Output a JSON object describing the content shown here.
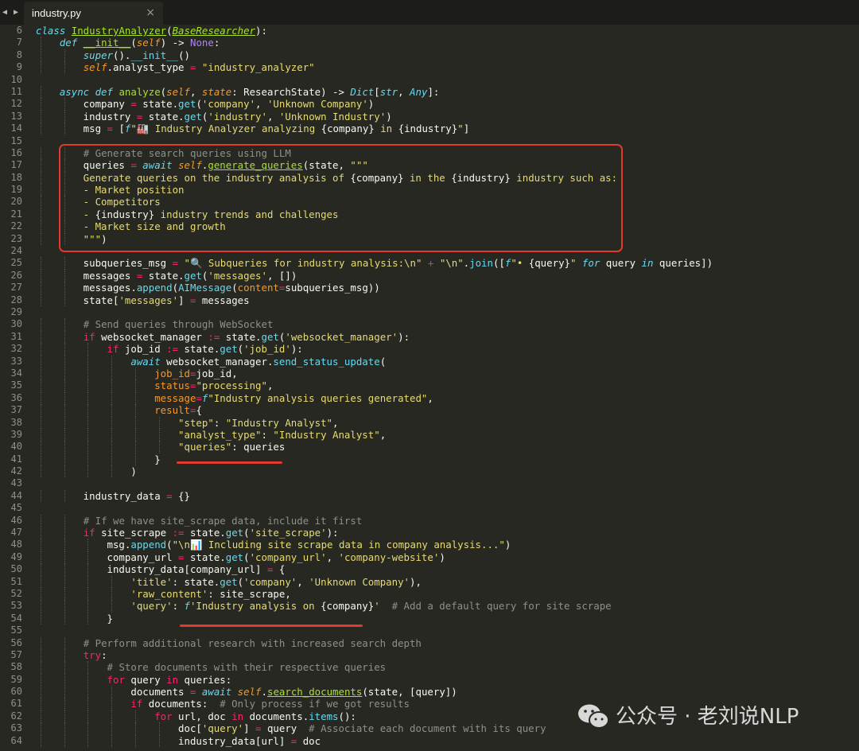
{
  "tab": {
    "title": "industry.py",
    "close": "×"
  },
  "nav_arrows": "◀ ▶",
  "line_numbers": [
    "6",
    "7",
    "8",
    "9",
    "10",
    "11",
    "12",
    "13",
    "14",
    "15",
    "16",
    "17",
    "18",
    "19",
    "20",
    "21",
    "22",
    "23",
    "24",
    "25",
    "26",
    "27",
    "28",
    "29",
    "30",
    "31",
    "32",
    "33",
    "34",
    "35",
    "36",
    "37",
    "38",
    "39",
    "40",
    "41",
    "42",
    "43",
    "44",
    "45",
    "46",
    "47",
    "48",
    "49",
    "50",
    "51",
    "52",
    "53",
    "54",
    "55",
    "56",
    "57",
    "58",
    "59",
    "60",
    "61",
    "62",
    "63",
    "64"
  ],
  "code_lines": [
    [
      [
        "kw",
        "class "
      ],
      [
        "cls",
        "IndustryAnalyzer"
      ],
      [
        "",
        "("
      ],
      [
        "inh",
        "BaseResearcher"
      ],
      [
        "",
        "):"
      ]
    ],
    [
      [
        "",
        "    "
      ],
      [
        "kw",
        "def "
      ],
      [
        "fnu",
        "__init__"
      ],
      [
        "",
        "("
      ],
      [
        "prm",
        "self"
      ],
      [
        "",
        ") -> "
      ],
      [
        "none",
        "None"
      ],
      [
        "",
        ":"
      ]
    ],
    [
      [
        "",
        "        "
      ],
      [
        "kw",
        "super"
      ],
      [
        "",
        "()."
      ],
      [
        "mth",
        "__init__"
      ],
      [
        "",
        "()"
      ]
    ],
    [
      [
        "",
        "        "
      ],
      [
        "self",
        "self"
      ],
      [
        "",
        ".analyst_type "
      ],
      [
        "op",
        "="
      ],
      [
        "",
        " "
      ],
      [
        "str",
        "\"industry_analyzer\""
      ]
    ],
    [
      [
        "",
        ""
      ]
    ],
    [
      [
        "",
        "    "
      ],
      [
        "kw",
        "async def "
      ],
      [
        "fn",
        "analyze"
      ],
      [
        "",
        "("
      ],
      [
        "prm",
        "self"
      ],
      [
        "",
        ", "
      ],
      [
        "prm",
        "state"
      ],
      [
        "",
        ": ResearchState) -> "
      ],
      [
        "typ",
        "Dict"
      ],
      [
        "",
        "["
      ],
      [
        "typ",
        "str"
      ],
      [
        "",
        ", "
      ],
      [
        "typ",
        "Any"
      ],
      [
        "",
        "]:"
      ]
    ],
    [
      [
        "",
        "        company "
      ],
      [
        "op",
        "="
      ],
      [
        "",
        " state."
      ],
      [
        "mth",
        "get"
      ],
      [
        "",
        "("
      ],
      [
        "str",
        "'company'"
      ],
      [
        "",
        ", "
      ],
      [
        "str",
        "'Unknown Company'"
      ],
      [
        "",
        ")"
      ]
    ],
    [
      [
        "",
        "        industry "
      ],
      [
        "op",
        "="
      ],
      [
        "",
        " state."
      ],
      [
        "mth",
        "get"
      ],
      [
        "",
        "("
      ],
      [
        "str",
        "'industry'"
      ],
      [
        "",
        ", "
      ],
      [
        "str",
        "'Unknown Industry'"
      ],
      [
        "",
        ")"
      ]
    ],
    [
      [
        "",
        "        msg "
      ],
      [
        "op",
        "="
      ],
      [
        "",
        " ["
      ],
      [
        "kw",
        "f"
      ],
      [
        "str",
        "\"🏭 Industry Analyzer analyzing "
      ],
      [
        "",
        "{company}"
      ],
      [
        "str",
        " in "
      ],
      [
        "",
        "{industry}"
      ],
      [
        "str",
        "\""
      ],
      [
        "",
        "]"
      ]
    ],
    [
      [
        "",
        ""
      ]
    ],
    [
      [
        "",
        "        "
      ],
      [
        "cmt",
        "# Generate search queries using LLM"
      ]
    ],
    [
      [
        "",
        "        queries "
      ],
      [
        "op",
        "="
      ],
      [
        "",
        " "
      ],
      [
        "kw",
        "await "
      ],
      [
        "self",
        "self"
      ],
      [
        "",
        "."
      ],
      [
        "fnu",
        "generate_queries"
      ],
      [
        "",
        "(state, "
      ],
      [
        "str",
        "\"\"\""
      ]
    ],
    [
      [
        "str",
        "        Generate queries on the industry analysis of "
      ],
      [
        "",
        "{company}"
      ],
      [
        "str",
        " in the "
      ],
      [
        "",
        "{industry}"
      ],
      [
        "str",
        " industry such as:"
      ]
    ],
    [
      [
        "str",
        "        - Market position"
      ]
    ],
    [
      [
        "str",
        "        - Competitors"
      ]
    ],
    [
      [
        "str",
        "        - "
      ],
      [
        "",
        "{industry}"
      ],
      [
        "str",
        " industry trends and challenges"
      ]
    ],
    [
      [
        "str",
        "        - Market size and growth"
      ]
    ],
    [
      [
        "str",
        "        \"\"\""
      ],
      [
        "",
        ")"
      ]
    ],
    [
      [
        "",
        ""
      ]
    ],
    [
      [
        "",
        "        subqueries_msg "
      ],
      [
        "op",
        "="
      ],
      [
        "",
        " "
      ],
      [
        "str",
        "\"🔍 Subqueries for industry analysis:\\n\""
      ],
      [
        "",
        " "
      ],
      [
        "op",
        "+"
      ],
      [
        "",
        " "
      ],
      [
        "str",
        "\"\\n\""
      ],
      [
        "",
        "."
      ],
      [
        "mth",
        "join"
      ],
      [
        "",
        "(["
      ],
      [
        "kw",
        "f"
      ],
      [
        "str",
        "\"• "
      ],
      [
        "",
        "{query}"
      ],
      [
        "str",
        "\""
      ],
      [
        "",
        " "
      ],
      [
        "kw",
        "for"
      ],
      [
        "",
        ""
      ],
      [
        "",
        " query "
      ],
      [
        "kw",
        "in"
      ],
      [
        "",
        " queries])"
      ]
    ],
    [
      [
        "",
        "        messages "
      ],
      [
        "op",
        "="
      ],
      [
        "",
        " state."
      ],
      [
        "mth",
        "get"
      ],
      [
        "",
        "("
      ],
      [
        "str",
        "'messages'"
      ],
      [
        "",
        ", [])"
      ]
    ],
    [
      [
        "",
        "        messages."
      ],
      [
        "mth",
        "append"
      ],
      [
        "",
        "("
      ],
      [
        "mth",
        "AIMessage"
      ],
      [
        "",
        "("
      ],
      [
        "arg",
        "content"
      ],
      [
        "op",
        "="
      ],
      [
        "",
        "subqueries_msg))"
      ]
    ],
    [
      [
        "",
        "        state["
      ],
      [
        "str",
        "'messages'"
      ],
      [
        "",
        "] "
      ],
      [
        "op",
        "="
      ],
      [
        "",
        " messages"
      ]
    ],
    [
      [
        "",
        ""
      ]
    ],
    [
      [
        "",
        "        "
      ],
      [
        "cmt",
        "# Send queries through WebSocket"
      ]
    ],
    [
      [
        "",
        "        "
      ],
      [
        "op",
        "if"
      ],
      [
        "",
        " websocket_manager "
      ],
      [
        "op",
        ":="
      ],
      [
        "",
        " state."
      ],
      [
        "mth",
        "get"
      ],
      [
        "",
        "("
      ],
      [
        "str",
        "'websocket_manager'"
      ],
      [
        "",
        "):"
      ]
    ],
    [
      [
        "",
        "            "
      ],
      [
        "op",
        "if"
      ],
      [
        "",
        " job_id "
      ],
      [
        "op",
        ":="
      ],
      [
        "",
        " state."
      ],
      [
        "mth",
        "get"
      ],
      [
        "",
        "("
      ],
      [
        "str",
        "'job_id'"
      ],
      [
        "",
        "):"
      ]
    ],
    [
      [
        "",
        "                "
      ],
      [
        "kw",
        "await "
      ],
      [
        "",
        "websocket_manager."
      ],
      [
        "mth",
        "send_status_update"
      ],
      [
        "",
        "("
      ]
    ],
    [
      [
        "",
        "                    "
      ],
      [
        "arg",
        "job_id"
      ],
      [
        "op",
        "="
      ],
      [
        "",
        "job_id,"
      ]
    ],
    [
      [
        "",
        "                    "
      ],
      [
        "arg",
        "status"
      ],
      [
        "op",
        "="
      ],
      [
        "str",
        "\"processing\""
      ],
      [
        "",
        ","
      ]
    ],
    [
      [
        "",
        "                    "
      ],
      [
        "arg",
        "message"
      ],
      [
        "op",
        "="
      ],
      [
        "kw",
        "f"
      ],
      [
        "str",
        "\"Industry analysis queries generated\""
      ],
      [
        "",
        ","
      ]
    ],
    [
      [
        "",
        "                    "
      ],
      [
        "arg",
        "result"
      ],
      [
        "op",
        "="
      ],
      [
        "",
        "{"
      ]
    ],
    [
      [
        "",
        "                        "
      ],
      [
        "str",
        "\"step\""
      ],
      [
        "",
        ": "
      ],
      [
        "str",
        "\"Industry Analyst\""
      ],
      [
        "",
        ","
      ]
    ],
    [
      [
        "",
        "                        "
      ],
      [
        "str",
        "\"analyst_type\""
      ],
      [
        "",
        ": "
      ],
      [
        "str",
        "\"Industry Analyst\""
      ],
      [
        "",
        ","
      ]
    ],
    [
      [
        "",
        "                        "
      ],
      [
        "str",
        "\"queries\""
      ],
      [
        "",
        ": queries"
      ]
    ],
    [
      [
        "",
        "                    }"
      ]
    ],
    [
      [
        "",
        "                )"
      ]
    ],
    [
      [
        "",
        ""
      ]
    ],
    [
      [
        "",
        "        industry_data "
      ],
      [
        "op",
        "="
      ],
      [
        "",
        " {}"
      ]
    ],
    [
      [
        "",
        ""
      ]
    ],
    [
      [
        "",
        "        "
      ],
      [
        "cmt",
        "# If we have site_scrape data, include it first"
      ]
    ],
    [
      [
        "",
        "        "
      ],
      [
        "op",
        "if"
      ],
      [
        "",
        " site_scrape "
      ],
      [
        "op",
        ":="
      ],
      [
        "",
        " state."
      ],
      [
        "mth",
        "get"
      ],
      [
        "",
        "("
      ],
      [
        "str",
        "'site_scrape'"
      ],
      [
        "",
        "):"
      ]
    ],
    [
      [
        "",
        "            msg."
      ],
      [
        "mth",
        "append"
      ],
      [
        "",
        "("
      ],
      [
        "str",
        "\"\\n📊 Including site scrape data in company analysis...\""
      ],
      [
        "",
        ")"
      ]
    ],
    [
      [
        "",
        "            company_url "
      ],
      [
        "op",
        "="
      ],
      [
        "",
        " state."
      ],
      [
        "mth",
        "get"
      ],
      [
        "",
        "("
      ],
      [
        "str",
        "'company_url'"
      ],
      [
        "",
        ", "
      ],
      [
        "str",
        "'company-website'"
      ],
      [
        "",
        ")"
      ]
    ],
    [
      [
        "",
        "            industry_data[company_url] "
      ],
      [
        "op",
        "="
      ],
      [
        "",
        " {"
      ]
    ],
    [
      [
        "",
        "                "
      ],
      [
        "str",
        "'title'"
      ],
      [
        "",
        ": state."
      ],
      [
        "mth",
        "get"
      ],
      [
        "",
        "("
      ],
      [
        "str",
        "'company'"
      ],
      [
        "",
        ", "
      ],
      [
        "str",
        "'Unknown Company'"
      ],
      [
        "",
        "),"
      ]
    ],
    [
      [
        "",
        "                "
      ],
      [
        "str",
        "'raw_content'"
      ],
      [
        "",
        ": site_scrape,"
      ]
    ],
    [
      [
        "",
        "                "
      ],
      [
        "str",
        "'query'"
      ],
      [
        "",
        ": "
      ],
      [
        "kw",
        "f"
      ],
      [
        "str",
        "'Industry analysis on "
      ],
      [
        "",
        "{company}"
      ],
      [
        "str",
        "'"
      ],
      [
        "",
        "  "
      ],
      [
        "cmt",
        "# Add a default query for site scrape"
      ]
    ],
    [
      [
        "",
        "            }"
      ]
    ],
    [
      [
        "",
        ""
      ]
    ],
    [
      [
        "",
        "        "
      ],
      [
        "cmt",
        "# Perform additional research with increased search depth"
      ]
    ],
    [
      [
        "",
        "        "
      ],
      [
        "op",
        "try"
      ],
      [
        "",
        ":"
      ]
    ],
    [
      [
        "",
        "            "
      ],
      [
        "cmt",
        "# Store documents with their respective queries"
      ]
    ],
    [
      [
        "",
        "            "
      ],
      [
        "op",
        "for"
      ],
      [
        "",
        " query "
      ],
      [
        "op",
        "in"
      ],
      [
        "",
        " queries:"
      ]
    ],
    [
      [
        "",
        "                documents "
      ],
      [
        "op",
        "="
      ],
      [
        "",
        " "
      ],
      [
        "kw",
        "await "
      ],
      [
        "self",
        "self"
      ],
      [
        "",
        "."
      ],
      [
        "fnu",
        "search_documents"
      ],
      [
        "",
        "(state, [query])"
      ]
    ],
    [
      [
        "",
        "                "
      ],
      [
        "op",
        "if"
      ],
      [
        "",
        " documents:  "
      ],
      [
        "cmt",
        "# Only process if we got results"
      ]
    ],
    [
      [
        "",
        "                    "
      ],
      [
        "op",
        "for"
      ],
      [
        "",
        " url, doc "
      ],
      [
        "op",
        "in"
      ],
      [
        "",
        " documents."
      ],
      [
        "mth",
        "items"
      ],
      [
        "",
        "():"
      ]
    ],
    [
      [
        "",
        "                        doc["
      ],
      [
        "str",
        "'query'"
      ],
      [
        "",
        "] "
      ],
      [
        "op",
        "="
      ],
      [
        "",
        " query  "
      ],
      [
        "cmt",
        "# Associate each document with its query"
      ]
    ],
    [
      [
        "",
        "                        industry_data[url] "
      ],
      [
        "op",
        "="
      ],
      [
        "",
        " doc"
      ]
    ]
  ],
  "watermark": {
    "text": "公众号 · 老刘说NLP",
    "icon": "wechat-icon"
  },
  "colors": {
    "background": "#272822",
    "highlight": "#e23a2e"
  }
}
